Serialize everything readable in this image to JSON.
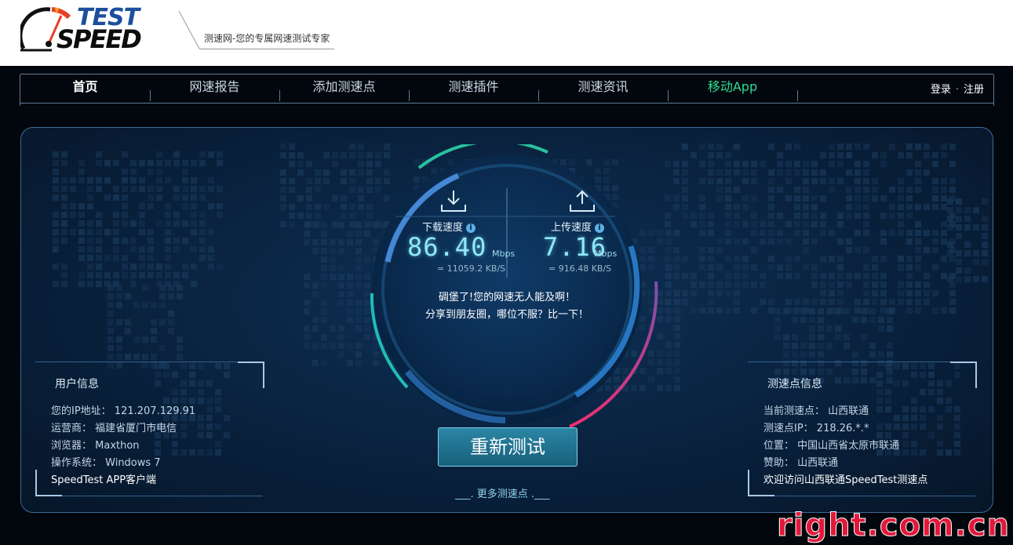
{
  "header": {
    "logo_top": "TEST",
    "logo_bottom": "SPEED",
    "slogan": "测速网-您的专属网速测试专家"
  },
  "nav": {
    "items": [
      {
        "label": "首页"
      },
      {
        "label": "网速报告"
      },
      {
        "label": "添加测速点"
      },
      {
        "label": "测速插件"
      },
      {
        "label": "测速资讯"
      },
      {
        "label": "移动App"
      }
    ],
    "login": "登录",
    "register": "注册",
    "separator": "·"
  },
  "colors": {
    "background": "#02070d",
    "panel": "#0a2442",
    "accent_green": "#2fdc94",
    "value_cyan": "#8fe9f6",
    "arc_pink": "#e0357a",
    "watermark_red": "#e2183b"
  },
  "speed": {
    "download_label": "下载速度",
    "download_value": "86.40",
    "download_unit": "Mbps",
    "download_kbs": "= 11059.2  KB/S",
    "upload_label": "上传速度",
    "upload_value": "7.16",
    "upload_unit": "Mbps",
    "upload_kbs": "= 916.48  KB/S",
    "info_icon": "i",
    "message_line1": "碉堡了!您的网速无人能及啊！",
    "message_line2": "分享到朋友圈，哪位不服？比一下！",
    "retest_label": "重新测试",
    "more_points": "___. 更多测速点 .___"
  },
  "user_info": {
    "title": "用户信息",
    "ip": "您的IP地址：  121.207.129.91",
    "isp": "运营商：  福建省厦门市电信",
    "browser": "浏览器：  Maxthon",
    "os": "操作系统：  Windows 7",
    "app_link": "SpeedTest APP客户端"
  },
  "server_info": {
    "title": "测速点信息",
    "current": "当前测速点：  山西联通",
    "ip": "测速点IP：  218.26.*.*",
    "location": "位置：  中国山西省太原市联通",
    "sponsor": "赞助：  山西联通",
    "welcome": "欢迎访问山西联通SpeedTest测速点"
  },
  "watermark": "right.com.cn"
}
